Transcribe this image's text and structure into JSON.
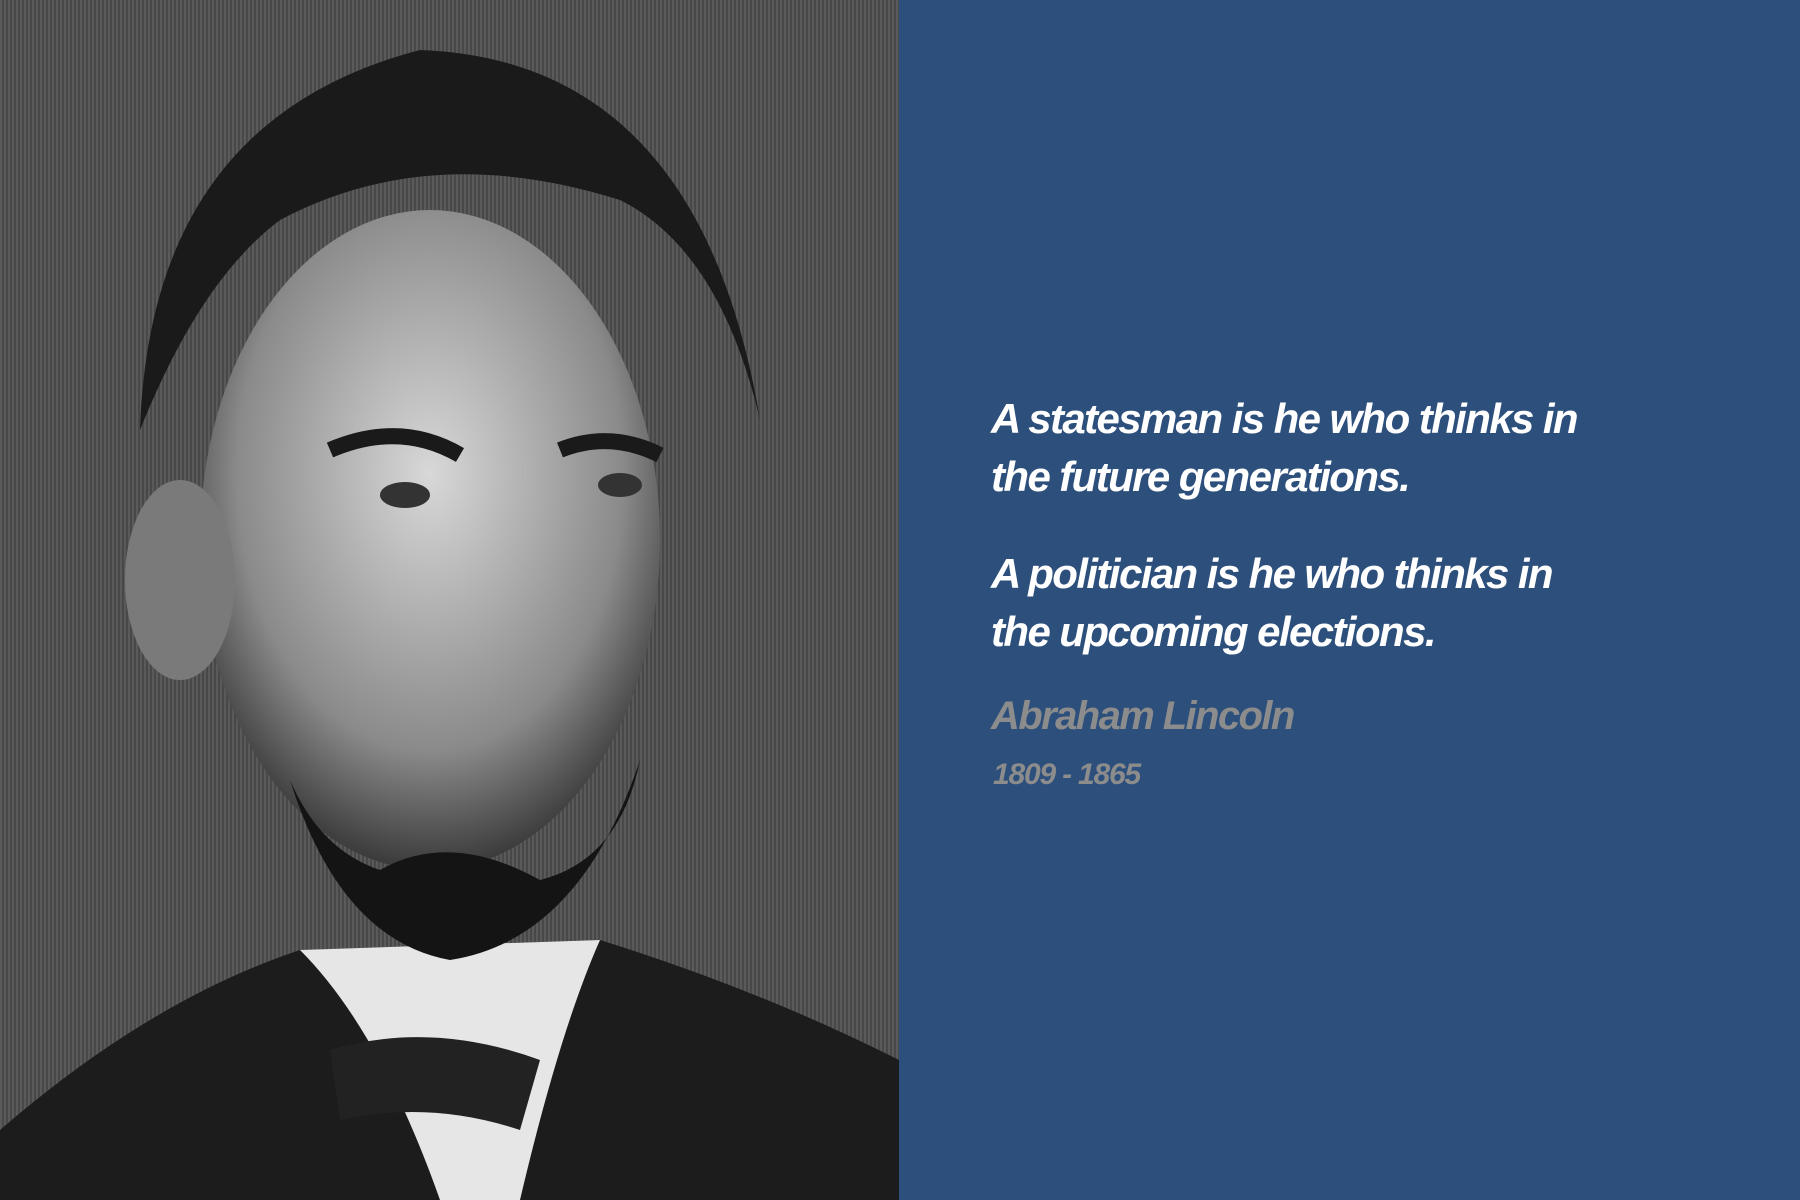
{
  "quote": {
    "statesman": [
      "A statesman is he who thinks in",
      "the future generations."
    ],
    "politician": [
      "A politician is he who thinks in",
      "the upcoming elections."
    ]
  },
  "attribution": {
    "name": "Abraham Lincoln",
    "years": "1809 - 1865"
  },
  "colors": {
    "panel_background": "#2d4f7c",
    "quote_text": "#ffffff",
    "attribution_text": "#8c8c8c"
  },
  "image": {
    "subject": "black-and-white engraved portrait"
  }
}
